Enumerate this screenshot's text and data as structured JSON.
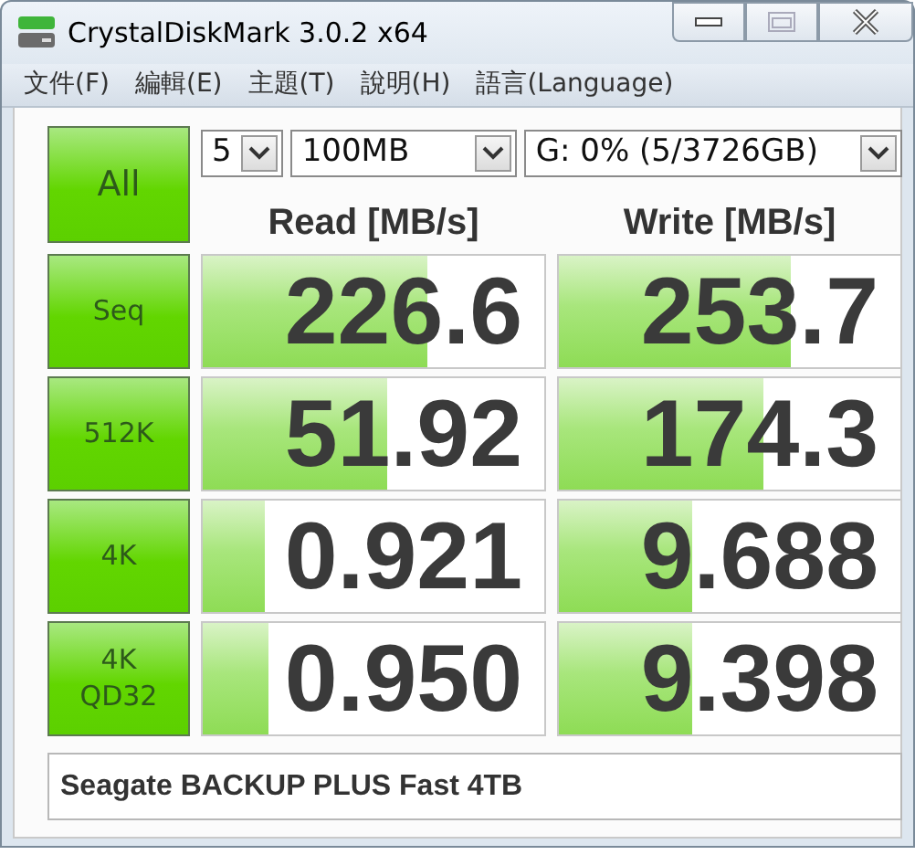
{
  "window": {
    "title": "CrystalDiskMark 3.0.2 x64"
  },
  "menu": [
    "文件(F)",
    "編輯(E)",
    "主題(T)",
    "說明(H)",
    "語言(Language)"
  ],
  "controls": {
    "all_button": "All",
    "count": "5",
    "size": "100MB",
    "drive": "G: 0% (5/3726GB)"
  },
  "columns": [
    "Read [MB/s]",
    "Write [MB/s]"
  ],
  "rows": [
    {
      "label": "Seq",
      "read": {
        "value": "226.6",
        "level": 0.66
      },
      "write": {
        "value": "253.7",
        "level": 0.68
      }
    },
    {
      "label": "512K",
      "read": {
        "value": "51.92",
        "level": 0.54
      },
      "write": {
        "value": "174.3",
        "level": 0.6
      }
    },
    {
      "label": "4K",
      "read": {
        "value": "0.921",
        "level": 0.18
      },
      "write": {
        "value": "9.688",
        "level": 0.39
      }
    },
    {
      "label": "4K\nQD32",
      "read": {
        "value": "0.950",
        "level": 0.19
      },
      "write": {
        "value": "9.398",
        "level": 0.39
      }
    }
  ],
  "comment": "Seagate BACKUP PLUS Fast 4TB"
}
